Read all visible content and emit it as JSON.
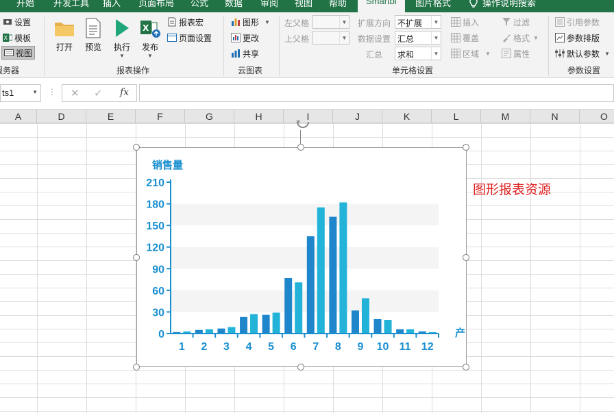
{
  "tabs": [
    "开始",
    "开发工具",
    "插入",
    "页面布局",
    "公式",
    "数据",
    "审阅",
    "视图",
    "帮助",
    "Smartbi",
    "图片格式",
    "操作说明搜索"
  ],
  "ribbon": {
    "server_group": {
      "items": [
        "设置",
        "模板",
        "视图"
      ],
      "label": "服务器"
    },
    "report_ops": {
      "buttons": [
        "打开",
        "预览",
        "执行",
        "发布"
      ],
      "macro": "报表宏",
      "page_setup": "页面设置",
      "label": "报表操作"
    },
    "cloud_chart": {
      "items": [
        "图形",
        "更改",
        "共享"
      ],
      "label": "云图表"
    },
    "cell_settings": {
      "left_parent": "左父格",
      "top_parent": "上父格",
      "expand_dir": "扩展方向",
      "expand_value": "不扩展",
      "data_setting": "数据设置",
      "data_value": "汇总",
      "summary": "汇总",
      "summary_value": "求和",
      "insert": "插入",
      "overlay": "覆盖",
      "region": "区域",
      "filter": "过滤",
      "format": "格式",
      "property": "属性",
      "label": "单元格设置"
    },
    "params": {
      "items": [
        "引用参数",
        "参数排版",
        "默认参数"
      ],
      "label": "参数设置"
    }
  },
  "formula_bar": {
    "name_box": "ts1",
    "fx": "fx"
  },
  "columns": [
    "A",
    "D",
    "E",
    "F",
    "G",
    "H",
    "I",
    "J",
    "K",
    "L",
    "M",
    "N",
    "O"
  ],
  "note": "图形报表资源",
  "chart_data": {
    "type": "bar",
    "title": "",
    "ylabel": "销售量",
    "xlabel": "产",
    "categories": [
      "1",
      "2",
      "3",
      "4",
      "5",
      "6",
      "7",
      "8",
      "9",
      "10",
      "11",
      "12"
    ],
    "series": [
      {
        "values": [
          2,
          5,
          7,
          23,
          26,
          77,
          135,
          162,
          32,
          20,
          6,
          3
        ]
      },
      {
        "values": [
          3,
          6,
          9,
          27,
          29,
          71,
          175,
          182,
          49,
          19,
          6,
          2
        ]
      }
    ],
    "yticks": [
      0,
      30,
      60,
      90,
      120,
      150,
      180,
      210
    ],
    "ylim": [
      0,
      210
    ],
    "colors": [
      "#1f86cc",
      "#23b3d9"
    ],
    "axis_color": "#1a8fd0"
  }
}
